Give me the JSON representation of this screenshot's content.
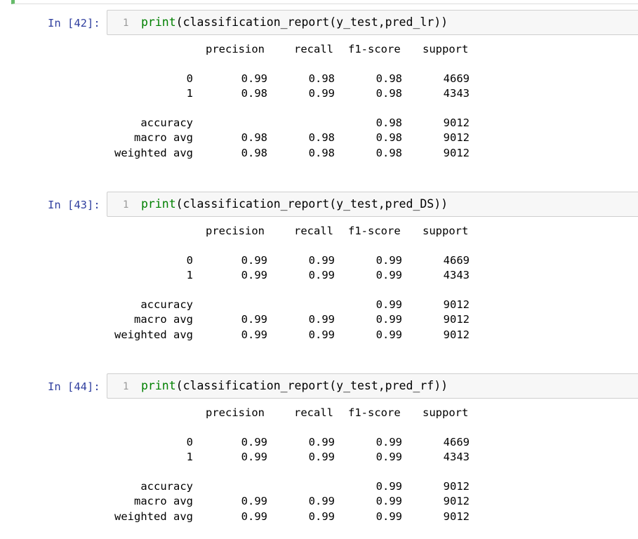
{
  "cells": [
    {
      "prompt": "In [42]:",
      "line_number": "1",
      "code_fn": "print",
      "code_rest": "(classification_report(y_test,pred_lr))",
      "headers": [
        "precision",
        "recall",
        "f1-score",
        "support"
      ],
      "rows": [
        {
          "label": "0",
          "precision": "0.99",
          "recall": "0.98",
          "f1": "0.98",
          "support": "4669"
        },
        {
          "label": "1",
          "precision": "0.98",
          "recall": "0.99",
          "f1": "0.98",
          "support": "4343"
        },
        {
          "label": "accuracy",
          "precision": "",
          "recall": "",
          "f1": "0.98",
          "support": "9012"
        },
        {
          "label": "macro avg",
          "precision": "0.98",
          "recall": "0.98",
          "f1": "0.98",
          "support": "9012"
        },
        {
          "label": "weighted avg",
          "precision": "0.98",
          "recall": "0.98",
          "f1": "0.98",
          "support": "9012"
        }
      ]
    },
    {
      "prompt": "In [43]:",
      "line_number": "1",
      "code_fn": "print",
      "code_rest": "(classification_report(y_test,pred_DS))",
      "headers": [
        "precision",
        "recall",
        "f1-score",
        "support"
      ],
      "rows": [
        {
          "label": "0",
          "precision": "0.99",
          "recall": "0.99",
          "f1": "0.99",
          "support": "4669"
        },
        {
          "label": "1",
          "precision": "0.99",
          "recall": "0.99",
          "f1": "0.99",
          "support": "4343"
        },
        {
          "label": "accuracy",
          "precision": "",
          "recall": "",
          "f1": "0.99",
          "support": "9012"
        },
        {
          "label": "macro avg",
          "precision": "0.99",
          "recall": "0.99",
          "f1": "0.99",
          "support": "9012"
        },
        {
          "label": "weighted avg",
          "precision": "0.99",
          "recall": "0.99",
          "f1": "0.99",
          "support": "9012"
        }
      ]
    },
    {
      "prompt": "In [44]:",
      "line_number": "1",
      "code_fn": "print",
      "code_rest": "(classification_report(y_test,pred_rf))",
      "headers": [
        "precision",
        "recall",
        "f1-score",
        "support"
      ],
      "rows": [
        {
          "label": "0",
          "precision": "0.99",
          "recall": "0.99",
          "f1": "0.99",
          "support": "4669"
        },
        {
          "label": "1",
          "precision": "0.99",
          "recall": "0.99",
          "f1": "0.99",
          "support": "4343"
        },
        {
          "label": "accuracy",
          "precision": "",
          "recall": "",
          "f1": "0.99",
          "support": "9012"
        },
        {
          "label": "macro avg",
          "precision": "0.99",
          "recall": "0.99",
          "f1": "0.99",
          "support": "9012"
        },
        {
          "label": "weighted avg",
          "precision": "0.99",
          "recall": "0.99",
          "f1": "0.99",
          "support": "9012"
        }
      ]
    }
  ],
  "colors": {
    "prompt": "#303f9f",
    "keyword": "#008000",
    "selected_cell_border": "#66bb6a"
  }
}
